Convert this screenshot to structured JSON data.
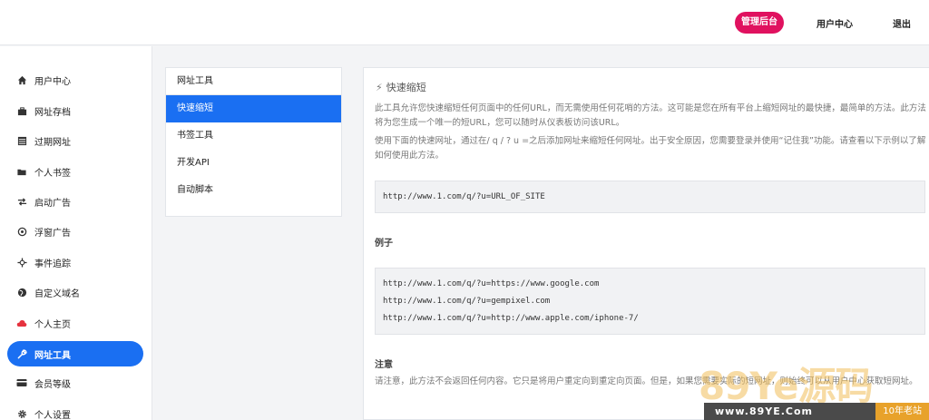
{
  "header": {
    "admin_label": "管理后台",
    "user_center_label": "用户中心",
    "logout_label": "退出"
  },
  "sidebar": {
    "items": [
      {
        "label": "用户中心",
        "icon": "home-icon"
      },
      {
        "label": "网址存档",
        "icon": "briefcase-icon"
      },
      {
        "label": "过期网址",
        "icon": "list-icon"
      },
      {
        "label": "个人书签",
        "icon": "folder-icon"
      },
      {
        "label": "启动广告",
        "icon": "swap-icon"
      },
      {
        "label": "浮窗广告",
        "icon": "target-icon"
      },
      {
        "label": "事件追踪",
        "icon": "crosshair-icon"
      },
      {
        "label": "自定义域名",
        "icon": "globe-icon"
      },
      {
        "label": "个人主页",
        "icon": "cloud-icon"
      },
      {
        "label": "网址工具",
        "icon": "wrench-icon"
      },
      {
        "label": "会员等级",
        "icon": "card-icon"
      },
      {
        "label": "个人设置",
        "icon": "gear-icon"
      }
    ],
    "active_index": 9
  },
  "submenu": {
    "title": "网址工具",
    "items": [
      "快速缩短",
      "书签工具",
      "开发API",
      "自动脚本"
    ],
    "active_index": 0
  },
  "main": {
    "title": "快速缩短",
    "intro": "此工具允许您快速缩短任何页面中的任何URL，而无需使用任何花哨的方法。这可能是您在所有平台上缩短网址的最快捷，最简单的方法。此方法将为您生成一个唯一的短URL，您可以随时从仪表板访问该URL。",
    "instruction": "使用下面的快速网址，通过在/ q / ? u =之后添加网址来缩短任何网址。出于安全原因，您需要登录并使用“记住我”功能。请查看以下示例以了解如何使用此方法。",
    "template_url": "http://www.1.com/q/?u=URL_OF_SITE",
    "examples_heading": "例子",
    "examples": [
      "http://www.1.com/q/?u=https://www.google.com",
      "http://www.1.com/q/?u=gempixel.com",
      "http://www.1.com/q/?u=http://www.apple.com/iphone-7/"
    ],
    "note_heading": "注意",
    "note": "请注意，此方法不会返回任何内容。它只是将用户重定向到重定向页面。但是，如果您需要实际的短网址，则始终可以从用户中心获取短网址。"
  },
  "watermark": {
    "logo_text": "89Ye源码",
    "site": "www.89YE.Com",
    "tag": "10年老站"
  },
  "colors": {
    "accent_blue": "#1a6ff2",
    "admin_pink": "#e0115f"
  }
}
